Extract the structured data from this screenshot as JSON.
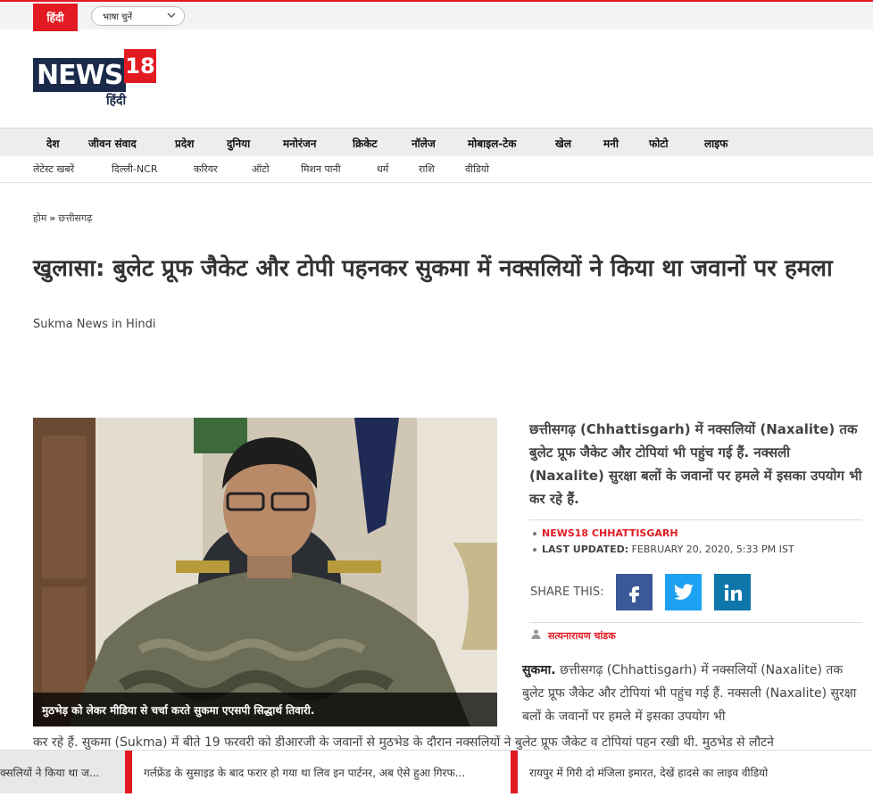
{
  "topbar": {
    "lang_badge": "हिंदी",
    "lang_select": "भाषा चुनें"
  },
  "logo": {
    "wordmark": "NEWS",
    "number": "18",
    "hindi": "हिंदी"
  },
  "nav_primary": [
    "देश",
    "जीवन संवाद",
    "प्रदेश",
    "दुनिया",
    "मनोरंजन",
    "क्रिकेट",
    "नॉलेज",
    "मोबाइल-टेक",
    "खेल",
    "मनी",
    "फोटो",
    "लाइफ"
  ],
  "nav_secondary": [
    "लेटेस्ट खबरें",
    "दिल्ली-NCR",
    "करियर",
    "ऑटो",
    "मिशन पानी",
    "धर्म",
    "राशि",
    "वीडियो"
  ],
  "breadcrumb": {
    "home": "होम",
    "separator": "»",
    "section": "छत्तीसगढ़"
  },
  "article": {
    "headline": "खुलासा: बुलेट प्रूफ जैकेट और टोपी पहनकर सुकमा में नक्सलियों ने किया था जवानों पर हमला",
    "subtitle": "Sukma News in Hindi",
    "photo_caption": "मुठभेड़ को लेकर मीडिया से चर्चा करते सुकमा एएसपी सिद्धार्थ तिवारी.",
    "summary": "छत्तीसगढ़ (Chhattisgarh) में नक्सलियों (Naxalite) तक बुलेट प्रूफ जैकेट और टोपियां भी पहुंच गई हैं. नक्सली (Naxalite) सुरक्षा बलों के जवानों पर हमले में इसका उपयोग भी कर रहे हैं.",
    "source": "NEWS18 CHHATTISGARH",
    "updated_label": "LAST UPDATED:",
    "updated_value": "FEBRUARY 20, 2020, 5:33 PM IST",
    "share_label": "SHARE THIS:",
    "author": "सत्यनारायण चांडक",
    "body_lead": "सुकमा.",
    "body_text": "छत्तीसगढ़ (Chhattisgarh) में नक्सलियों (Naxalite) तक बुलेट प्रूफ जैकेट और टोपियां भी पहुंच गई हैं. नक्सली (Naxalite) सुरक्षा बलों के जवानों पर हमले में इसका उपयोग भी",
    "body_text_cont": "कर रहे हैं. सुकमा (Sukma) में बीते 19 फरवरी को डीआरजी के जवानों से मुठभेड के दौरान नक्सलियों ने बुलेट प्रूफ जैकेट व टोपियां पहन रखी थी. मुठभेड से लौटने"
  },
  "share_buttons": [
    {
      "name": "facebook",
      "glyph": "f",
      "color": "#3b5998"
    },
    {
      "name": "twitter",
      "glyph": "twitter",
      "color": "#1da1f2"
    },
    {
      "name": "linkedin",
      "glyph": "in",
      "color": "#0e76a8"
    }
  ],
  "ticker": [
    "क्सलियों ने किया था ज...",
    "गर्लफ्रेंड के सुसाइड के बाद फरार हो गया था लिव इन पार्टनर, अब ऐसे हुआ गिरफ...",
    "रायपुर में गिरी दो मंजिला इमारत, देखें हादसे का लाइव वीडियो"
  ],
  "colors": {
    "brand_red": "#e21b22",
    "brand_navy": "#1b2a4a"
  }
}
